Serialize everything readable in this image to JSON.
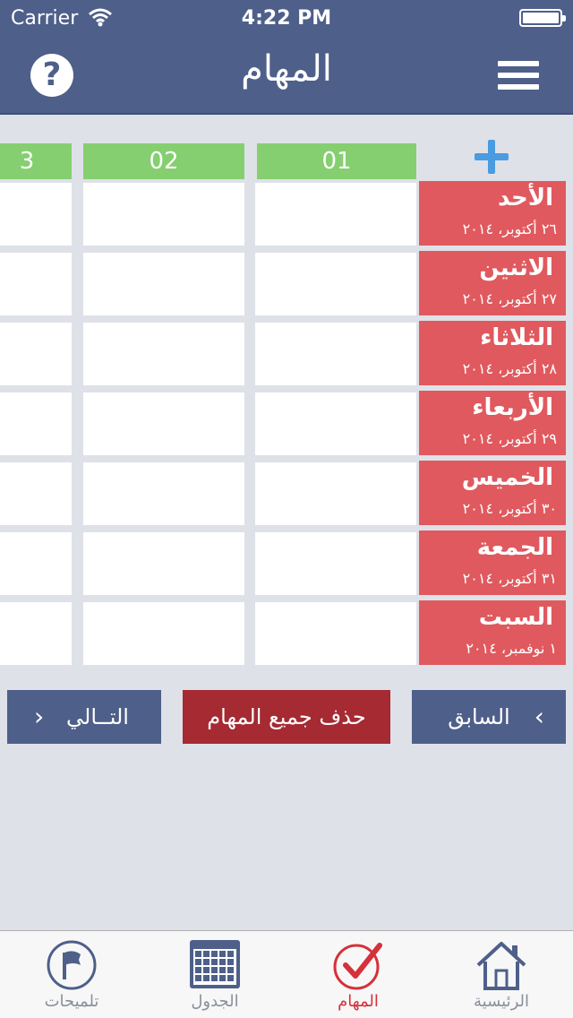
{
  "status_bar": {
    "carrier": "Carrier",
    "time": "4:22 PM"
  },
  "nav": {
    "title": "المهام",
    "help": "?"
  },
  "columns": [
    "3",
    "02",
    "01"
  ],
  "days": [
    {
      "name": "الأحد",
      "date": "٢٦ أكتوبر، ٢٠١٤"
    },
    {
      "name": "الاثنين",
      "date": "٢٧ أكتوبر، ٢٠١٤"
    },
    {
      "name": "الثلاثاء",
      "date": "٢٨ أكتوبر، ٢٠١٤"
    },
    {
      "name": "الأربعاء",
      "date": "٢٩ أكتوبر، ٢٠١٤"
    },
    {
      "name": "الخميس",
      "date": "٣٠ أكتوبر، ٢٠١٤"
    },
    {
      "name": "الجمعة",
      "date": "٣١ أكتوبر، ٢٠١٤"
    },
    {
      "name": "السبت",
      "date": "١ نوفمبر، ٢٠١٤"
    }
  ],
  "buttons": {
    "next": "التــالي",
    "delete_all": "حذف جميع المهام",
    "prev": "السابق"
  },
  "tabs": [
    {
      "label": "تلميحات",
      "icon": "flag-icon"
    },
    {
      "label": "الجدول",
      "icon": "calendar-icon"
    },
    {
      "label": "المهام",
      "icon": "checkmark-icon",
      "active": true
    },
    {
      "label": "الرئيسية",
      "icon": "home-icon"
    }
  ],
  "colors": {
    "nav": "#4e5f8a",
    "column_header": "#85cf71",
    "day_cell": "#e0595e",
    "delete_button": "#a52a32",
    "active_tab": "#d6303a",
    "add_icon": "#4a9be0"
  }
}
